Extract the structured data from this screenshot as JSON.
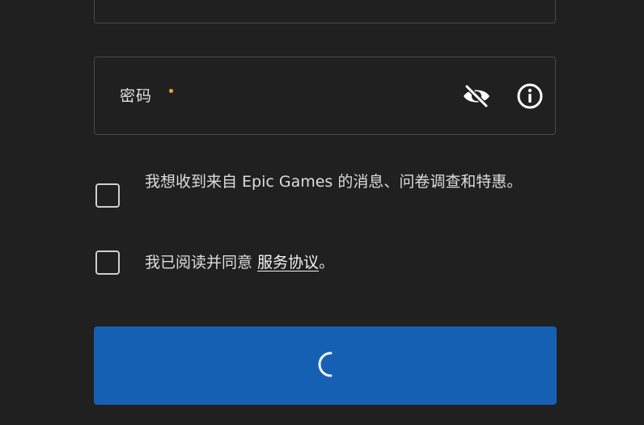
{
  "form": {
    "password_field": {
      "label": "密码",
      "required_marker_color": "#f2a23a",
      "visibility_icon": "eye-slash-icon",
      "info_icon": "info-icon"
    },
    "checkboxes": [
      {
        "text": "我想收到来自 Epic Games 的消息、问卷调查和特惠。",
        "checked": false
      },
      {
        "text_before": "我已阅读并同意 ",
        "link_text": "服务协议",
        "text_after": "。",
        "checked": false
      }
    ],
    "submit": {
      "state": "loading",
      "icon": "spinner-icon",
      "color": "#1660b4"
    }
  }
}
